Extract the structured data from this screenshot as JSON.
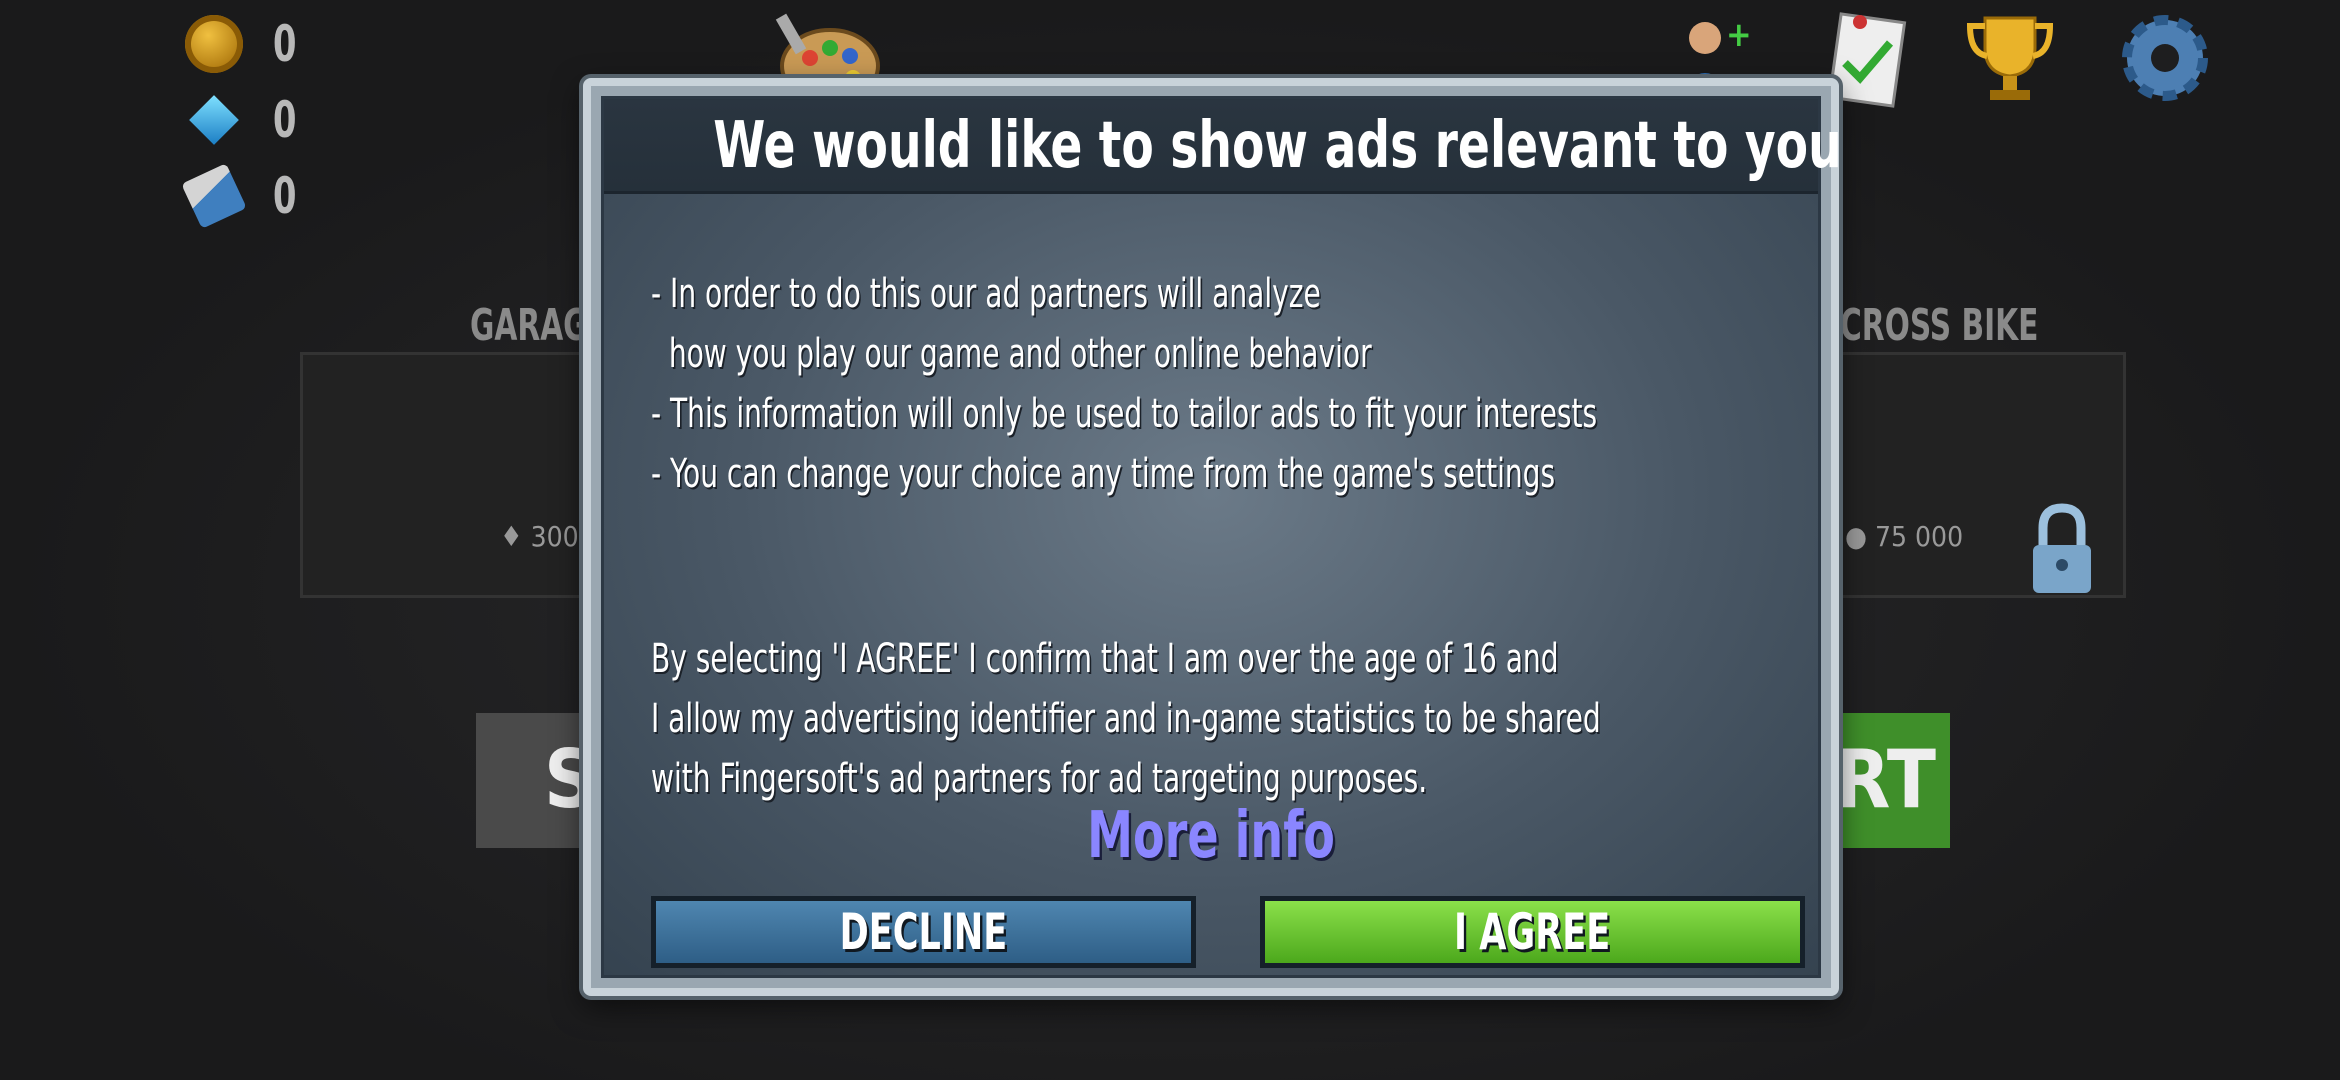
{
  "hud": {
    "coins": "0",
    "gems": "0",
    "paint": "0",
    "icons": [
      "palette-icon",
      "add-friend-icon",
      "checklist-icon",
      "trophy-icon",
      "settings-gear-icon"
    ]
  },
  "background": {
    "left_label": "GARAG",
    "left_price": "300",
    "right_label": "CROSS BIKE",
    "right_price": "75 000",
    "left_button_partial": "S",
    "right_button_partial": "RT"
  },
  "dialog": {
    "title": "We would like to show ads relevant to you",
    "bullets": [
      "- In order to do this our ad partners will analyze",
      "  how you play our game and other online behavior",
      "- This information will only be used to tailor ads to fit your interests",
      "- You can change your choice any time from the game's settings"
    ],
    "consent_lines": [
      "By selecting 'I AGREE' I confirm that I am over the age of 16 and",
      "I allow my advertising identifier and in-game statistics to be shared",
      "with Fingersoft's ad partners for ad targeting purposes."
    ],
    "more_info": "More info",
    "decline_label": "DECLINE",
    "agree_label": "I AGREE"
  },
  "colors": {
    "more_info": "#8a86ff",
    "agree": "#6cc834",
    "decline": "#3e719a",
    "panel": "#4a5866"
  }
}
